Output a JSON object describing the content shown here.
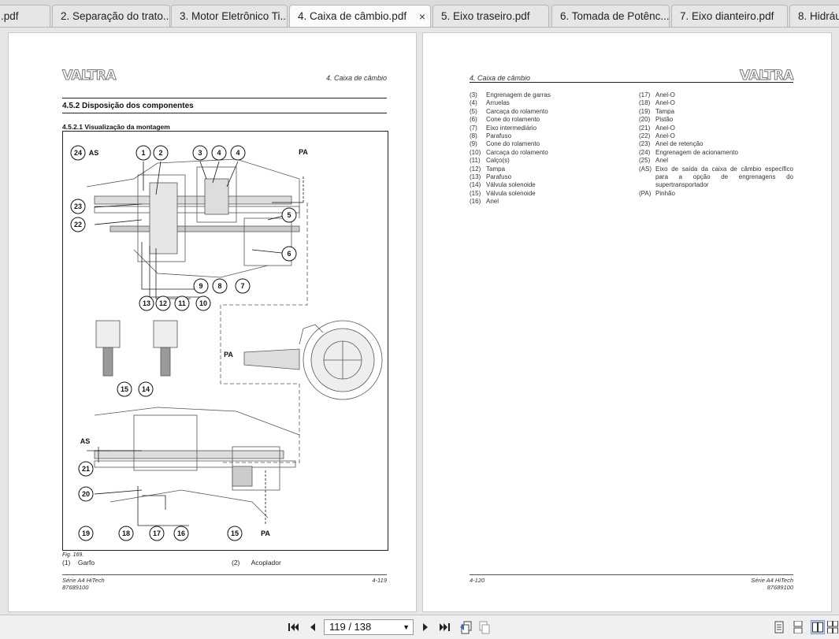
{
  "tabs": [
    {
      "label": ".pdf",
      "active": false
    },
    {
      "label": "2. Separação do trato...",
      "active": false
    },
    {
      "label": "3. Motor Eletrônico Ti...",
      "active": false
    },
    {
      "label": "4. Caixa de câmbio.pdf",
      "active": true
    },
    {
      "label": "5. Eixo traseiro.pdf",
      "active": false
    },
    {
      "label": "6. Tomada de Potênc...",
      "active": false
    },
    {
      "label": "7. Eixo dianteiro.pdf",
      "active": false
    },
    {
      "label": "8. Hidrául",
      "active": false
    }
  ],
  "tab_close_glyph": "×",
  "left_page": {
    "logo": "VALTRA",
    "header": "4. Caixa de câmbio",
    "section": "4.5.2  Disposição dos componentes",
    "subsection": "4.5.2.1  Visualização da montagem",
    "figure": {
      "callouts": [
        "1",
        "2",
        "3",
        "4",
        "4",
        "5",
        "6",
        "7",
        "8",
        "9",
        "10",
        "11",
        "12",
        "13",
        "14",
        "15",
        "16",
        "17",
        "18",
        "19",
        "20",
        "21",
        "22",
        "23",
        "24",
        "25"
      ],
      "labels": [
        "AS",
        "PA",
        "PA",
        "AS",
        "PA"
      ]
    },
    "fig_caption": "Fig. 169.",
    "legend": [
      {
        "key": "(1)",
        "text": "Garfo"
      },
      {
        "key": "(2)",
        "text": "Acoplador"
      }
    ],
    "footer_left_1": "Série A4 HiTech",
    "footer_left_2": "87689100",
    "footer_right": "4-119"
  },
  "right_page": {
    "logo": "VALTRA",
    "header": "4. Caixa de câmbio",
    "col1": [
      {
        "key": "(3)",
        "text": "Engrenagem de garras"
      },
      {
        "key": "(4)",
        "text": "Arruelas"
      },
      {
        "key": "(5)",
        "text": "Carcaça do rolamento"
      },
      {
        "key": "(6)",
        "text": "Cone do rolamento"
      },
      {
        "key": "(7)",
        "text": "Eixo intermediário"
      },
      {
        "key": "(8)",
        "text": "Parafuso"
      },
      {
        "key": "(9)",
        "text": "Cone do rolamento"
      },
      {
        "key": "(10)",
        "text": "Carcaça do rolamento"
      },
      {
        "key": "(11)",
        "text": "Calço(s)"
      },
      {
        "key": "(12)",
        "text": "Tampa"
      },
      {
        "key": "(13)",
        "text": "Parafuso"
      },
      {
        "key": "(14)",
        "text": "Válvula solenoide"
      },
      {
        "key": "(15)",
        "text": "Válvula solenoide"
      },
      {
        "key": "(16)",
        "text": "Anel"
      }
    ],
    "col2": [
      {
        "key": "(17)",
        "text": "Anel-O"
      },
      {
        "key": "(18)",
        "text": "Anel-O"
      },
      {
        "key": "(19)",
        "text": "Tampa"
      },
      {
        "key": "(20)",
        "text": "Pistão"
      },
      {
        "key": "(21)",
        "text": "Anel-O"
      },
      {
        "key": "(22)",
        "text": "Anel-O"
      },
      {
        "key": "(23)",
        "text": "Anel de retenção"
      },
      {
        "key": "(24)",
        "text": "Engrenagem de acionamento"
      },
      {
        "key": "(25)",
        "text": "Anel"
      },
      {
        "key": "(AS)",
        "text": "Eixo de saída da caixa de câmbio específico para a opção de engrenagens do supertransportador"
      },
      {
        "key": "(PA)",
        "text": "Pinhão"
      }
    ],
    "footer_left": "4-120",
    "footer_right_1": "Série A4 HiTech",
    "footer_right_2": "87689100"
  },
  "toolbar": {
    "page_indicator": "119 / 138",
    "icons": [
      "first-page-icon",
      "prev-page-icon",
      "next-page-icon",
      "last-page-icon",
      "back-icon",
      "forward-icon",
      "single-page-icon",
      "continuous-icon",
      "two-page-icon",
      "two-page-continuous-icon"
    ]
  }
}
